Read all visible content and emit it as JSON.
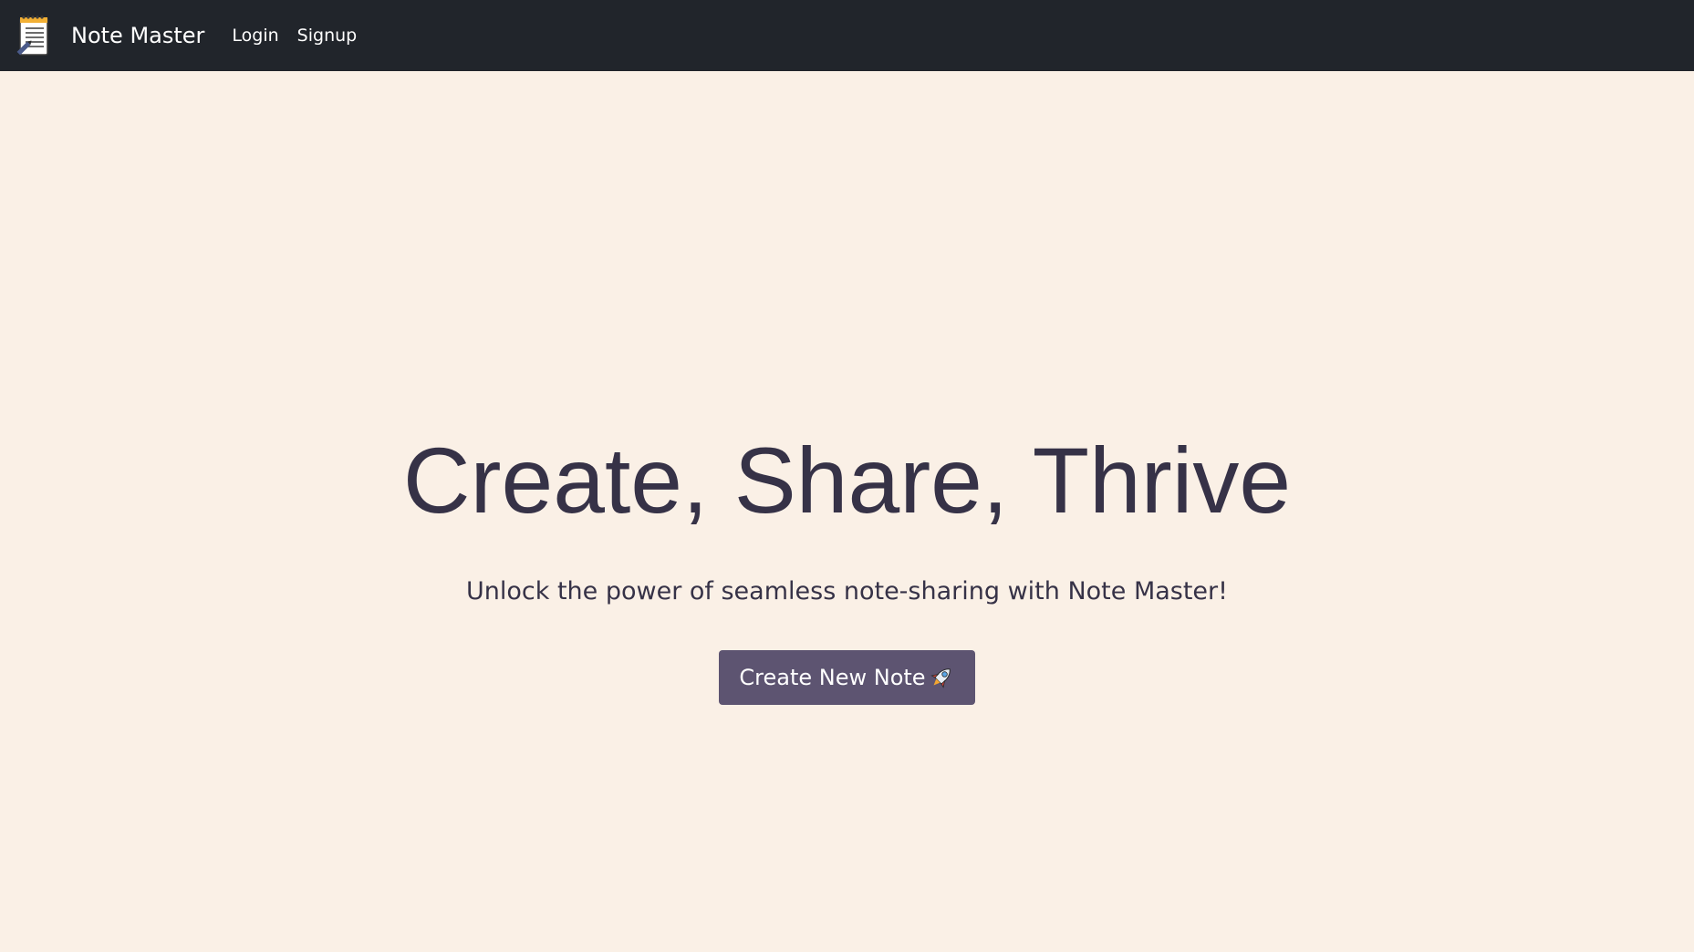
{
  "navbar": {
    "brand_name": "Note Master",
    "brand_icon": "notepad-icon",
    "links": [
      {
        "label": "Login"
      },
      {
        "label": "Signup"
      }
    ],
    "background": "#21252b"
  },
  "hero": {
    "title": "Create, Share, Thrive",
    "subtitle": "Unlock the power of seamless note-sharing with Note Master!",
    "cta_label": "Create New Note",
    "cta_icon": "rocket-icon"
  },
  "colors": {
    "page_background": "#faf0e6",
    "text": "#363247",
    "button": "#5d5471",
    "nav_text": "#ffffff"
  }
}
